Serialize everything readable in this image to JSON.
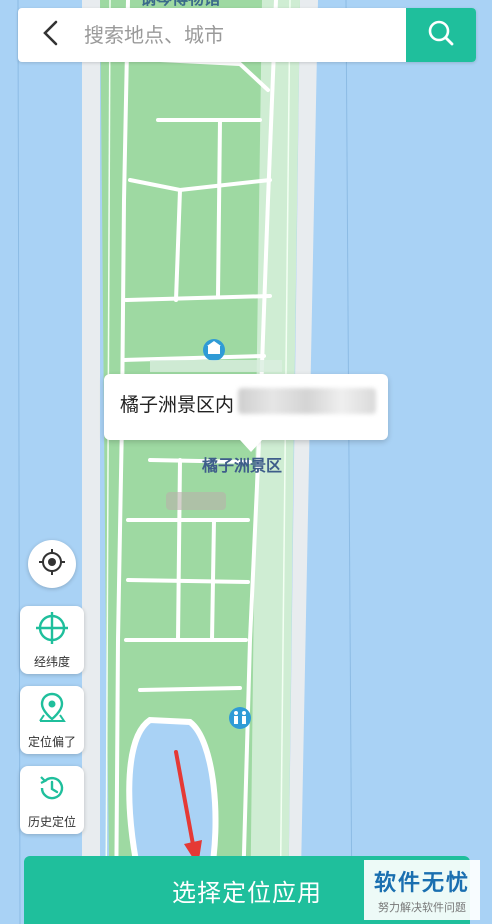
{
  "search": {
    "placeholder": "搜索地点、城市",
    "value": ""
  },
  "map": {
    "top_label": "钢琴博物馆",
    "area_label": "橘子洲景区"
  },
  "popup": {
    "location_text": "橘子洲景区内"
  },
  "side_buttons": {
    "latlng_label": "经纬度",
    "deviation_label": "定位偏了",
    "history_label": "历史定位"
  },
  "primary_action": {
    "label": "选择定位应用"
  },
  "watermark": {
    "title": "软件无忧",
    "subtitle": "努力解决软件问题"
  },
  "colors": {
    "accent": "#1fbf9c",
    "water": "#a9d2f5",
    "land": "#9ed9a2",
    "road": "#ffffff"
  },
  "icons": [
    "back-icon",
    "search-icon",
    "museum-icon",
    "toilet-icon",
    "locate-icon",
    "crosshair-icon",
    "pin-icon",
    "history-icon"
  ]
}
